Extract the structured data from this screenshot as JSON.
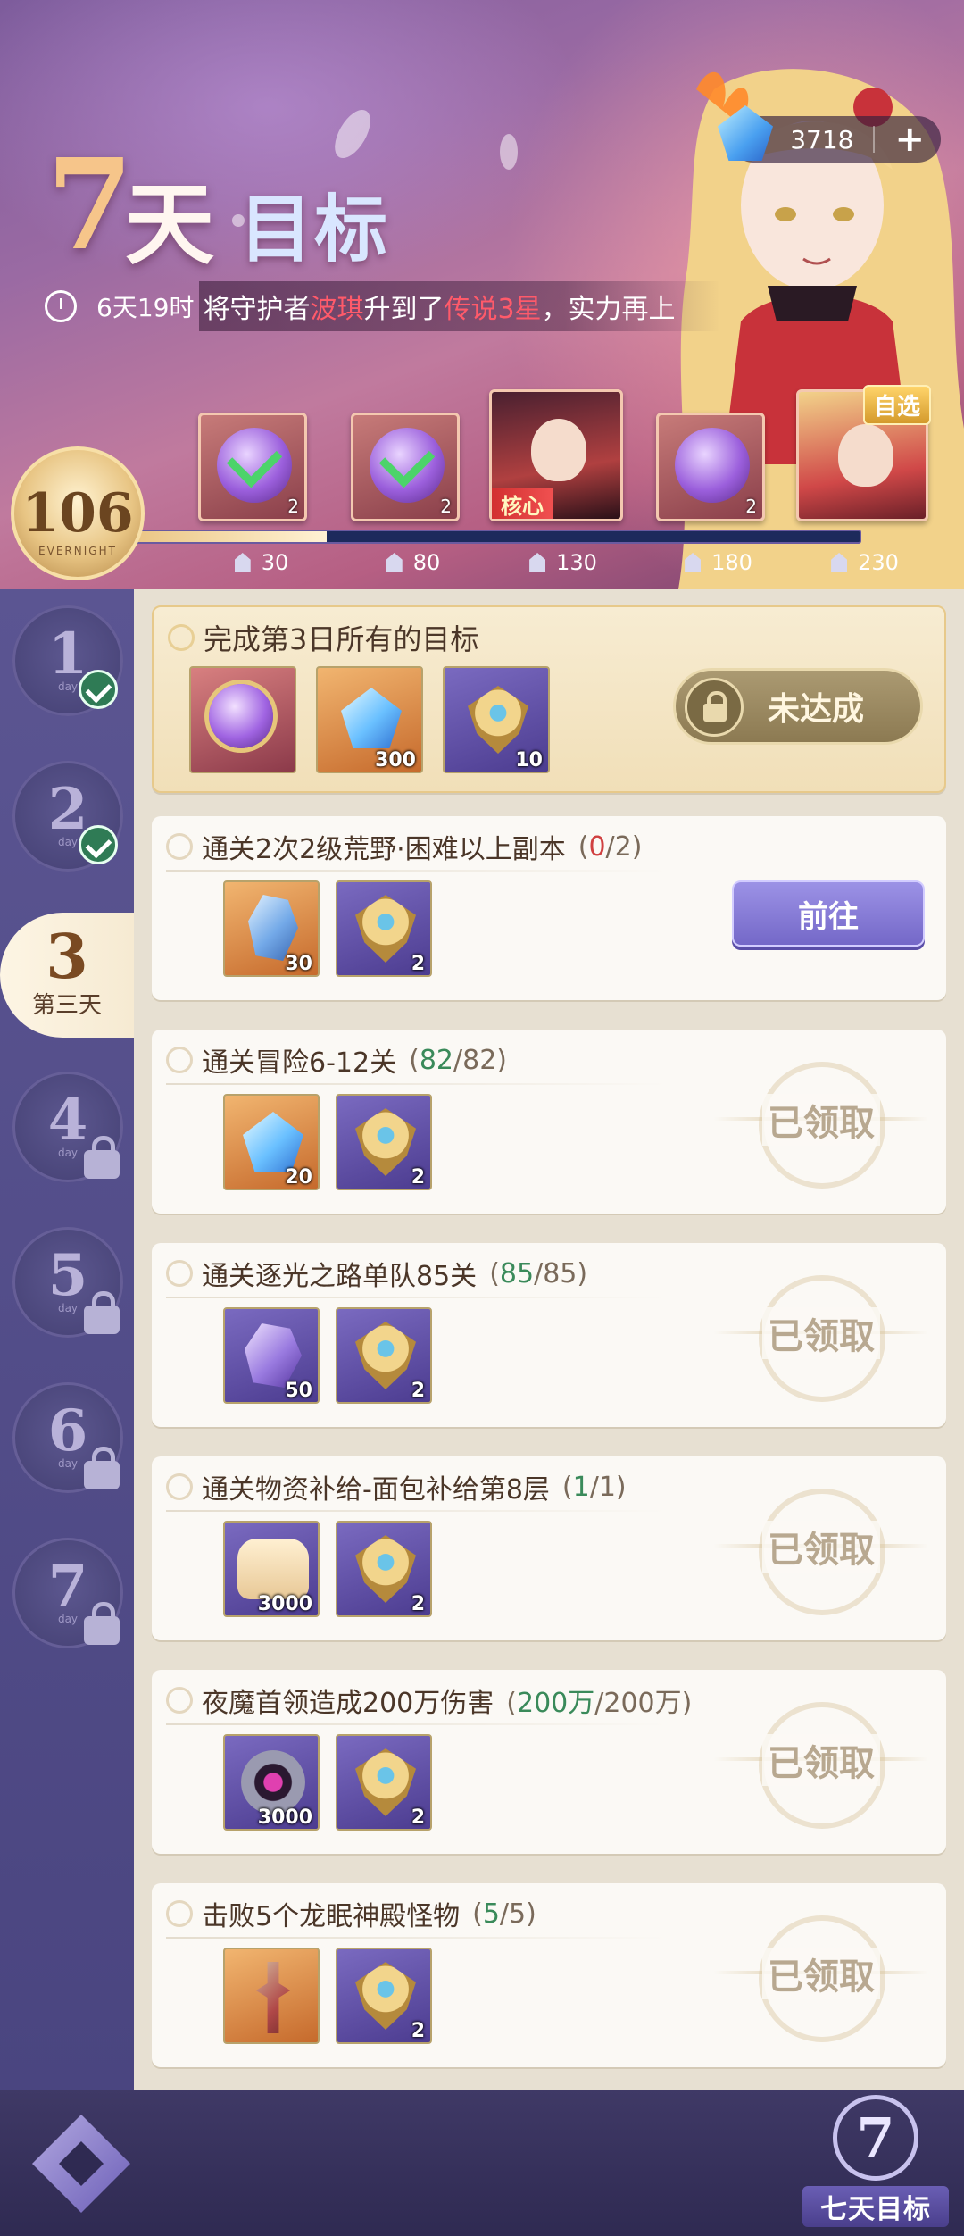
{
  "header": {
    "title_num": "7",
    "title_day": "天",
    "title_goal": "目标",
    "timer": "6天19时",
    "marquee": {
      "prefix": "将守护者",
      "hero": "波琪",
      "middle": "升到了",
      "rank": "传说3星",
      "suffix": "，实力再上"
    },
    "currency": {
      "value": "3718",
      "add_label": "+"
    }
  },
  "progress": {
    "level": "106",
    "level_caption": "EVERNIGHT",
    "fill_fraction": 0.29,
    "milestones": [
      {
        "points": "30",
        "qty": "2",
        "claimed": true
      },
      {
        "points": "80",
        "qty": "2",
        "claimed": true
      },
      {
        "points": "130",
        "tag": "核心",
        "claimed": false
      },
      {
        "points": "180",
        "qty": "2",
        "claimed": false
      },
      {
        "points": "230",
        "pick": "自选",
        "claimed": false
      }
    ]
  },
  "sidebar": {
    "days": [
      {
        "num": "1",
        "sub": "day",
        "state": "done"
      },
      {
        "num": "2",
        "sub": "day",
        "state": "done"
      },
      {
        "num": "3",
        "label": "第三天",
        "state": "active"
      },
      {
        "num": "4",
        "sub": "day",
        "state": "locked"
      },
      {
        "num": "5",
        "sub": "day",
        "state": "locked"
      },
      {
        "num": "6",
        "sub": "day",
        "state": "locked"
      },
      {
        "num": "7",
        "sub": "day",
        "state": "locked"
      }
    ]
  },
  "summary": {
    "title": "完成第3日所有的目标",
    "button": "未达成",
    "rewards": [
      {
        "icon": "purple-orb-icon",
        "qty": ""
      },
      {
        "icon": "diamond-icon",
        "qty": "300"
      },
      {
        "icon": "emblem-icon",
        "qty": "10"
      }
    ]
  },
  "tasks": [
    {
      "title": "通关2次2级荒野·困难以上副本",
      "prog_open": "(",
      "current": "0",
      "total": "/2)",
      "cur_color": "red",
      "action": "go",
      "action_label": "前往",
      "rewards": [
        {
          "icon": "blue-crystal-icon",
          "bg": "orange",
          "qty": "30"
        },
        {
          "icon": "emblem-icon",
          "bg": "purple",
          "qty": "2"
        }
      ]
    },
    {
      "title": "通关冒险6-12关",
      "prog_open": "(",
      "current": "82",
      "total": "/82)",
      "cur_color": "green",
      "action": "claimed",
      "action_label": "已领取",
      "rewards": [
        {
          "icon": "diamond-icon",
          "bg": "orange",
          "qty": "20"
        },
        {
          "icon": "emblem-icon",
          "bg": "purple",
          "qty": "2"
        }
      ]
    },
    {
      "title": "通关逐光之路单队85关",
      "prog_open": "(",
      "current": "85",
      "total": "/85)",
      "cur_color": "green",
      "action": "claimed",
      "action_label": "已领取",
      "rewards": [
        {
          "icon": "purple-shard-icon",
          "bg": "purple",
          "qty": "50"
        },
        {
          "icon": "emblem-icon",
          "bg": "purple",
          "qty": "2"
        }
      ]
    },
    {
      "title": "通关物资补给-面包补给第8层",
      "prog_open": "(",
      "current": "1",
      "total": "/1)",
      "cur_color": "green",
      "action": "claimed",
      "action_label": "已领取",
      "rewards": [
        {
          "icon": "bread-icon",
          "bg": "purple",
          "qty": "3000"
        },
        {
          "icon": "emblem-icon",
          "bg": "purple",
          "qty": "2"
        }
      ]
    },
    {
      "title": "夜魔首领造成200万伤害",
      "prog_open": "(",
      "current": "200万",
      "total": "/200万)",
      "cur_color": "green",
      "action": "claimed",
      "action_label": "已领取",
      "rewards": [
        {
          "icon": "ring-icon",
          "bg": "purple",
          "qty": "3000"
        },
        {
          "icon": "emblem-icon",
          "bg": "purple",
          "qty": "2"
        }
      ]
    },
    {
      "title": "击败5个龙眠神殿怪物",
      "prog_open": "(",
      "current": "5",
      "total": "/5)",
      "cur_color": "green",
      "action": "claimed",
      "action_label": "已领取",
      "rewards": [
        {
          "icon": "key-icon",
          "bg": "orange",
          "qty": ""
        },
        {
          "icon": "emblem-icon",
          "bg": "purple",
          "qty": "2"
        }
      ]
    }
  ],
  "footer": {
    "emblem_num": "7",
    "emblem_label": "七天目标"
  },
  "colors": {
    "accent_purple": "#7468c8",
    "progress_red": "#d04040",
    "progress_green": "#3a8a5a",
    "gold": "#e8c07a"
  }
}
